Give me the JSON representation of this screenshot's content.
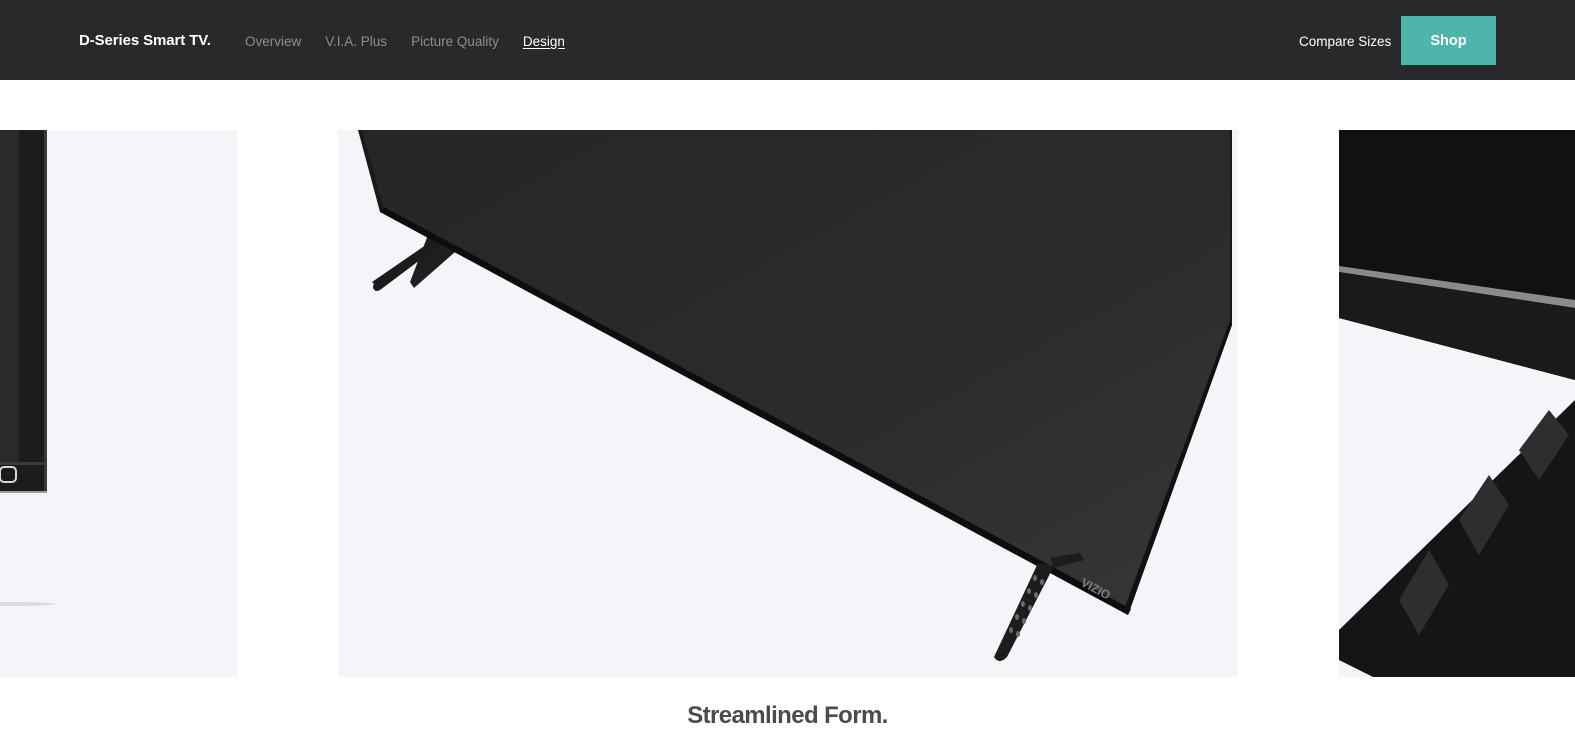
{
  "header": {
    "brand": "D-Series Smart TV.",
    "nav": [
      {
        "label": "Overview",
        "active": false
      },
      {
        "label": "V.I.A. Plus",
        "active": false
      },
      {
        "label": "Picture Quality",
        "active": false
      },
      {
        "label": "Design",
        "active": true
      }
    ],
    "compare_label": "Compare Sizes",
    "shop_label": "Shop"
  },
  "carousel": {
    "caption": "Streamlined Form.",
    "center_logo_text": "VIZIO"
  },
  "colors": {
    "header_bg": "#28292b",
    "accent": "#4fb5ab",
    "slide_bg": "#f4f5f9"
  }
}
